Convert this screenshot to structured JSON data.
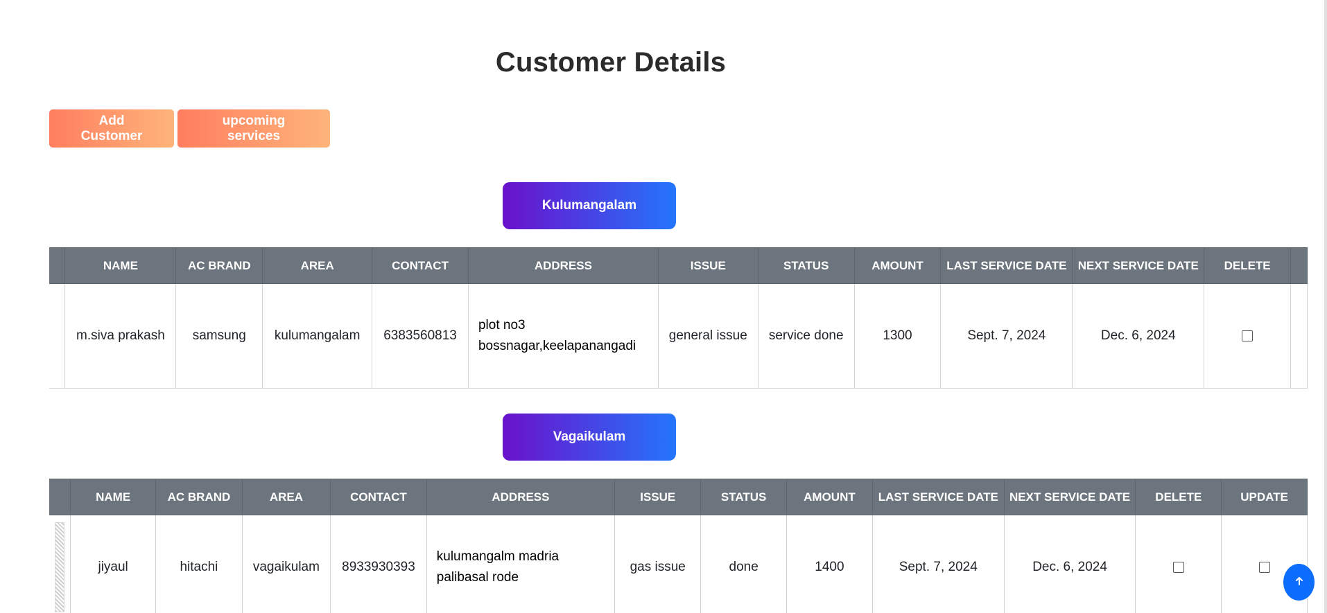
{
  "page": {
    "title": "Customer Details"
  },
  "actions": {
    "add_customer": "Add Customer",
    "upcoming_services": "upcoming services"
  },
  "columns": [
    "NAME",
    "AC BRAND",
    "AREA",
    "CONTACT",
    "ADDRESS",
    "ISSUE",
    "STATUS",
    "AMOUNT",
    "LAST SERVICE DATE",
    "NEXT SERVICE DATE",
    "DELETE",
    "UPDATE"
  ],
  "groups": [
    {
      "name": "Kulumangalam",
      "rows": [
        {
          "name": "m.siva prakash",
          "ac_brand": "samsung",
          "area": "kulumangalam",
          "contact": "6383560813",
          "address": "plot no3 bossnagar,keelapanangadi",
          "issue": "general issue",
          "status": "service done",
          "amount": "1300",
          "last_service_date": "Sept. 7, 2024",
          "next_service_date": "Dec. 6, 2024"
        }
      ]
    },
    {
      "name": "Vagaikulam",
      "rows": [
        {
          "name": "jiyaul",
          "ac_brand": "hitachi",
          "area": "vagaikulam",
          "contact": "8933930393",
          "address": "kulumangalm madria palibasal rode",
          "issue": "gas issue",
          "status": "done",
          "amount": "1400",
          "last_service_date": "Sept. 7, 2024",
          "next_service_date": "Dec. 6, 2024"
        }
      ]
    }
  ],
  "scroll_top_icon": "arrow-up-icon",
  "colors": {
    "orange_start": "#ff7e5f",
    "orange_end": "#feb47b",
    "purple_start": "#6a11cb",
    "blue_end": "#2575fc",
    "header_gray": "#6c757d",
    "scroll_button": "#0d6efd"
  }
}
